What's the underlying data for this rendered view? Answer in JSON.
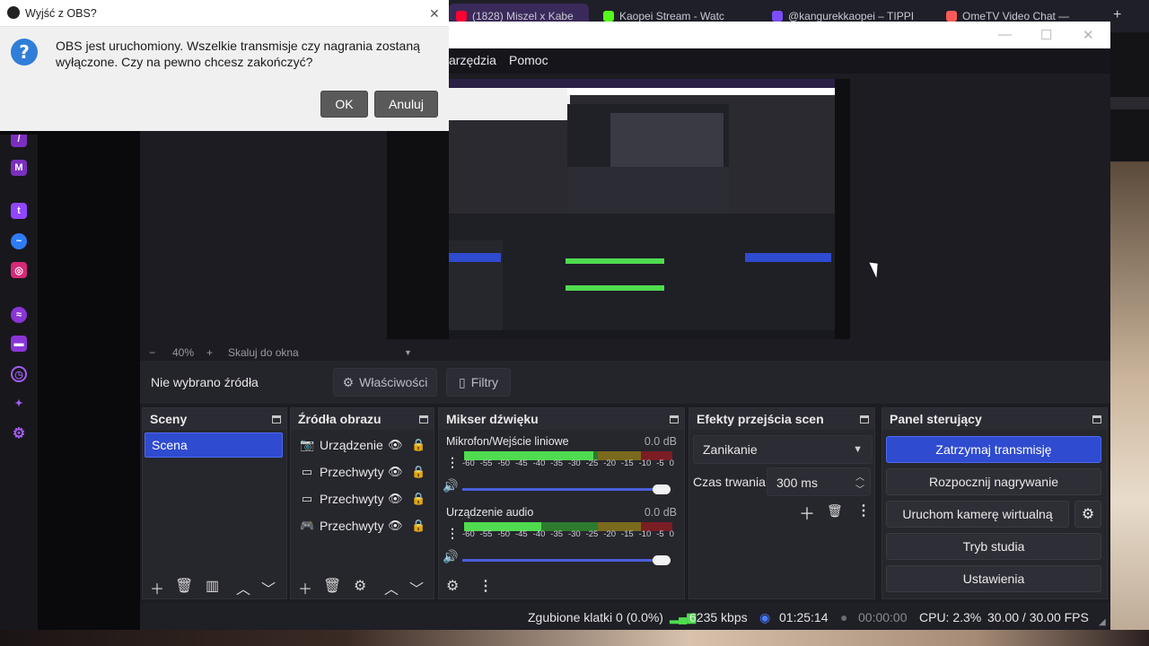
{
  "dialog": {
    "title": "Wyjść z OBS?",
    "message": "OBS jest uruchomiony. Wszelkie transmisje czy nagrania zostaną wyłączone. Czy na pewno chcesz zakończyć?",
    "ok_label": "OK",
    "cancel_label": "Anuluj",
    "close_glyph": "✕"
  },
  "browser": {
    "tabs": [
      {
        "label": "(1828) Miszel x Kabe",
        "icon": "youtube-icon",
        "color": "#ff0033"
      },
      {
        "label": "Kaopei Stream - Watc",
        "icon": "kick-icon",
        "color": "#53fc18"
      },
      {
        "label": "@kangurekkaopei – TIPPI",
        "icon": "tipply-icon",
        "color": "#7b4dff"
      },
      {
        "label": "OmeTV Video Chat —",
        "icon": "ometv-icon",
        "color": "#ff5a5a"
      }
    ],
    "new_tab": "+"
  },
  "obs": {
    "window_controls": {
      "minimize": "—",
      "maximize": "☐",
      "close": "✕"
    },
    "menu": [
      "arzędzia",
      "Pomoc"
    ],
    "zoom": {
      "minus": "−",
      "level": "40%",
      "plus": "+",
      "fit": "Skaluj do okna"
    },
    "source_toolbar": {
      "no_source": "Nie wybrano źródła",
      "properties": "Właściwości",
      "filters": "Filtry"
    },
    "scenes": {
      "title": "Sceny",
      "items": [
        "Scena"
      ]
    },
    "sources": {
      "title": "Źródła obrazu",
      "items": [
        {
          "name": "Urządzenie",
          "icon": "camera-icon"
        },
        {
          "name": "Przechwyty",
          "icon": "monitor-icon"
        },
        {
          "name": "Przechwyty",
          "icon": "monitor-icon"
        },
        {
          "name": "Przechwyty",
          "icon": "gamepad-icon"
        }
      ]
    },
    "mixer": {
      "title": "Mikser dźwięku",
      "ticks": [
        "-60",
        "-55",
        "-50",
        "-45",
        "-40",
        "-35",
        "-30",
        "-25",
        "-20",
        "-15",
        "-10",
        "-5",
        "0"
      ],
      "channels": [
        {
          "name": "Mikrofon/Wejście liniowe",
          "db": "0.0 dB",
          "level": 0.62,
          "volume": 1.0
        },
        {
          "name": "Urządzenie audio",
          "db": "0.0 dB",
          "level": 0.37,
          "volume": 1.0
        }
      ]
    },
    "transitions": {
      "title": "Efekty przejścia scen",
      "selected": "Zanikanie",
      "duration_label": "Czas trwania",
      "duration_value": "300 ms"
    },
    "controls": {
      "title": "Panel sterujący",
      "buttons": [
        "Zatrzymaj transmisję",
        "Rozpocznij nagrywanie",
        "Uruchom kamerę wirtualną",
        "Tryb studia",
        "Ustawienia"
      ]
    },
    "status": {
      "dropped": "Zgubione klatki 0 (0.0%)",
      "bitrate": "6235 kbps",
      "stream_time": "01:25:14",
      "rec_time": "00:00:00",
      "cpu": "CPU: 2.3%",
      "fps": "30.00 / 30.00 FPS"
    },
    "colors": {
      "accent": "#2f4bcf",
      "meter_green": "#4fdc4f",
      "live_green": "#4fdc4f"
    }
  }
}
